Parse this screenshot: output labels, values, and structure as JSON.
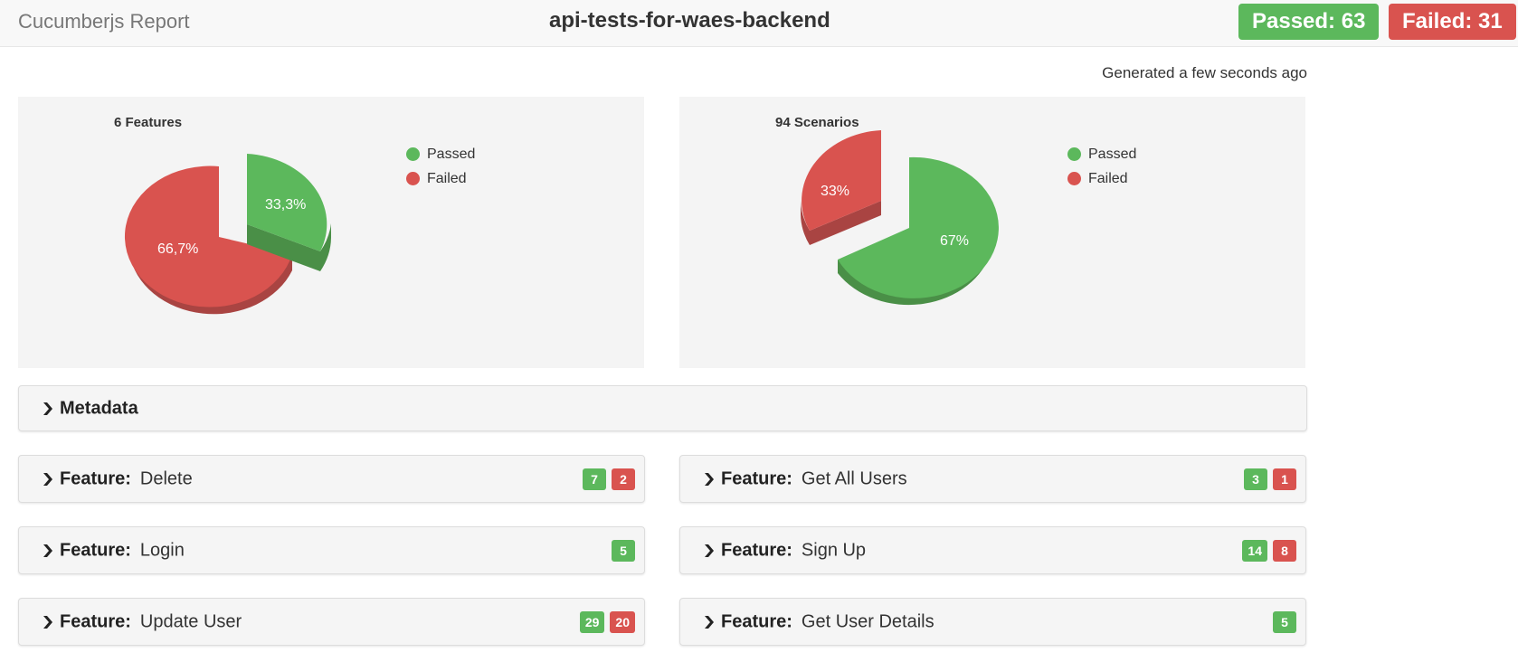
{
  "header": {
    "brand": "Cucumberjs Report",
    "project": "api-tests-for-waes-backend",
    "passed_label": "Passed: 63",
    "failed_label": "Failed: 31"
  },
  "generated_text": "Generated a few seconds ago",
  "colors": {
    "passed": "#5cb85c",
    "failed": "#d9534f"
  },
  "charts": {
    "features": {
      "title": "6 Features",
      "legend": [
        "Passed",
        "Failed"
      ],
      "passed_label": "33,3%",
      "failed_label": "66,7%"
    },
    "scenarios": {
      "title": "94 Scenarios",
      "legend": [
        "Passed",
        "Failed"
      ],
      "passed_label": "67%",
      "failed_label": "33%"
    }
  },
  "chart_data": [
    {
      "type": "pie",
      "title": "6 Features",
      "categories": [
        "Passed",
        "Failed"
      ],
      "values": [
        33.3,
        66.7
      ],
      "labels": [
        "33,3%",
        "66,7%"
      ],
      "legend": "top-right",
      "colors": [
        "#5cb85c",
        "#d9534f"
      ]
    },
    {
      "type": "pie",
      "title": "94 Scenarios",
      "categories": [
        "Passed",
        "Failed"
      ],
      "values": [
        67,
        33
      ],
      "labels": [
        "67%",
        "33%"
      ],
      "legend": "top-right",
      "colors": [
        "#5cb85c",
        "#d9534f"
      ]
    }
  ],
  "metadata": {
    "label": "Metadata"
  },
  "feature_keyword": "Feature:",
  "features": [
    {
      "name": "Delete",
      "passed": "7",
      "failed": "2"
    },
    {
      "name": "Get All Users",
      "passed": "3",
      "failed": "1"
    },
    {
      "name": "Login",
      "passed": "5",
      "failed": null
    },
    {
      "name": "Sign Up",
      "passed": "14",
      "failed": "8"
    },
    {
      "name": "Update User",
      "passed": "29",
      "failed": "20"
    },
    {
      "name": "Get User Details",
      "passed": "5",
      "failed": null
    }
  ]
}
